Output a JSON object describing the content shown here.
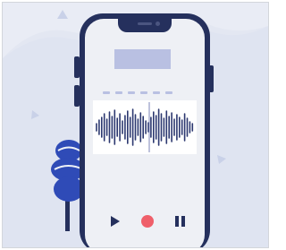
{
  "colors": {
    "background": "#dfe4f1",
    "backgroundShape": "#eef1f7",
    "phoneBody": "#25305d",
    "screen": "#eef0f5",
    "placeholder": "#b9c0e2",
    "waveform": "#2c3870",
    "recordButton": "#ef5f6a",
    "plant": "#2f4bb7",
    "plantStem": "#25305d"
  },
  "icons": {
    "play": "play-icon",
    "record": "record-icon",
    "pause": "pause-icon"
  }
}
